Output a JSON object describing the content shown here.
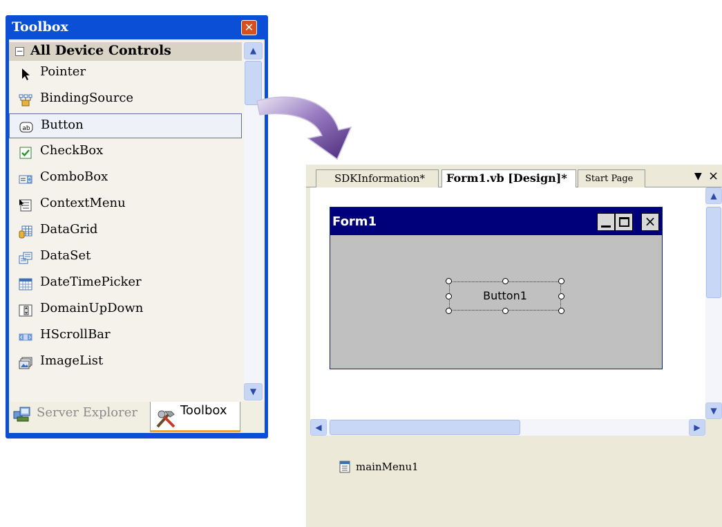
{
  "toolbox": {
    "title": "Toolbox",
    "close_glyph": "✕",
    "group_label": "All Device Controls",
    "collapse_glyph": "−",
    "items": [
      {
        "label": "Pointer",
        "icon": "pointer-icon"
      },
      {
        "label": "BindingSource",
        "icon": "binding-source-icon"
      },
      {
        "label": "Button",
        "icon": "button-control-icon",
        "selected": true
      },
      {
        "label": "CheckBox",
        "icon": "checkbox-icon"
      },
      {
        "label": "ComboBox",
        "icon": "combobox-icon"
      },
      {
        "label": "ContextMenu",
        "icon": "context-menu-icon"
      },
      {
        "label": "DataGrid",
        "icon": "datagrid-icon"
      },
      {
        "label": "DataSet",
        "icon": "dataset-icon"
      },
      {
        "label": "DateTimePicker",
        "icon": "datetime-picker-icon"
      },
      {
        "label": "DomainUpDown",
        "icon": "domain-updown-icon"
      },
      {
        "label": "HScrollBar",
        "icon": "hscrollbar-icon"
      },
      {
        "label": "ImageList",
        "icon": "imagelist-icon"
      }
    ],
    "tabs": {
      "server_explorer": "Server Explorer",
      "toolbox": "Toolbox"
    }
  },
  "designer": {
    "tabs": [
      {
        "label": "SDKInformation*",
        "active": false
      },
      {
        "label": "Form1.vb [Design]*",
        "active": true
      },
      {
        "label": "Start Page",
        "active": false
      }
    ],
    "form": {
      "title": "Form1",
      "button_label": "Button1"
    },
    "tray": {
      "component": "mainMenu1"
    }
  },
  "colors": {
    "toolbox_frame": "#0b4fd6",
    "form_titlebar": "#00007b",
    "form_background": "#c0c0c0",
    "arrow": "#6a3d9a"
  }
}
